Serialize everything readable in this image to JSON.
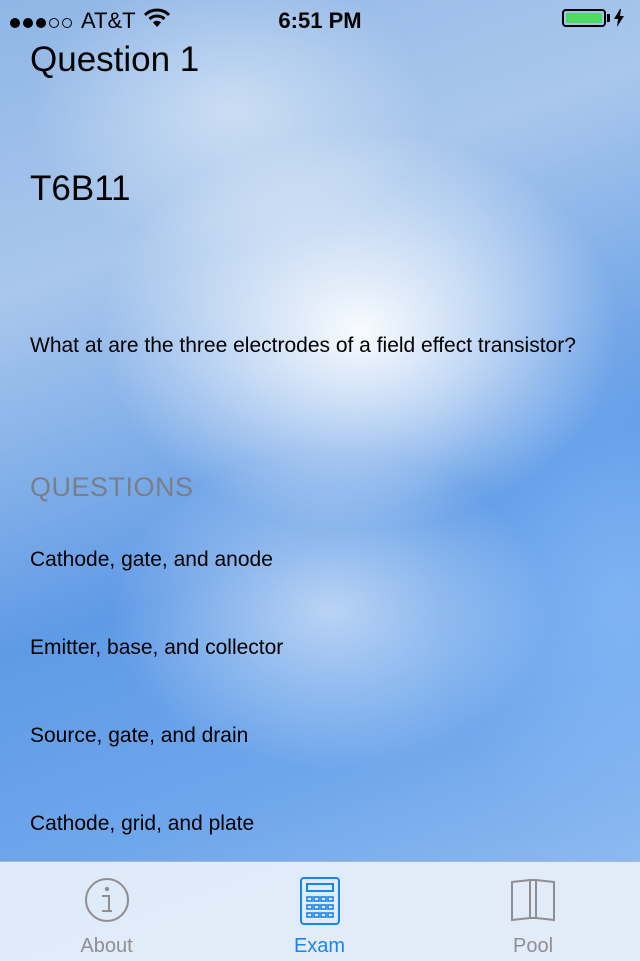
{
  "status_bar": {
    "carrier": "AT&T",
    "time": "6:51 PM",
    "signal_filled": 3,
    "signal_total": 5,
    "battery_color": "#4cd964"
  },
  "main": {
    "title": "Question 1",
    "code": "T6B11",
    "question": "What at are the three electrodes of a field effect transistor?",
    "section_header": "QUESTIONS",
    "answers": [
      "Cathode, gate, and anode",
      "Emitter, base, and collector",
      "Source, gate, and drain",
      "Cathode, grid, and plate"
    ]
  },
  "tab_bar": {
    "tabs": [
      {
        "label": "About",
        "icon": "info-icon",
        "active": false
      },
      {
        "label": "Exam",
        "icon": "calculator-icon",
        "active": true
      },
      {
        "label": "Pool",
        "icon": "book-icon",
        "active": false
      }
    ],
    "active_color": "#1a84ec",
    "inactive_color": "#8e8e93"
  }
}
